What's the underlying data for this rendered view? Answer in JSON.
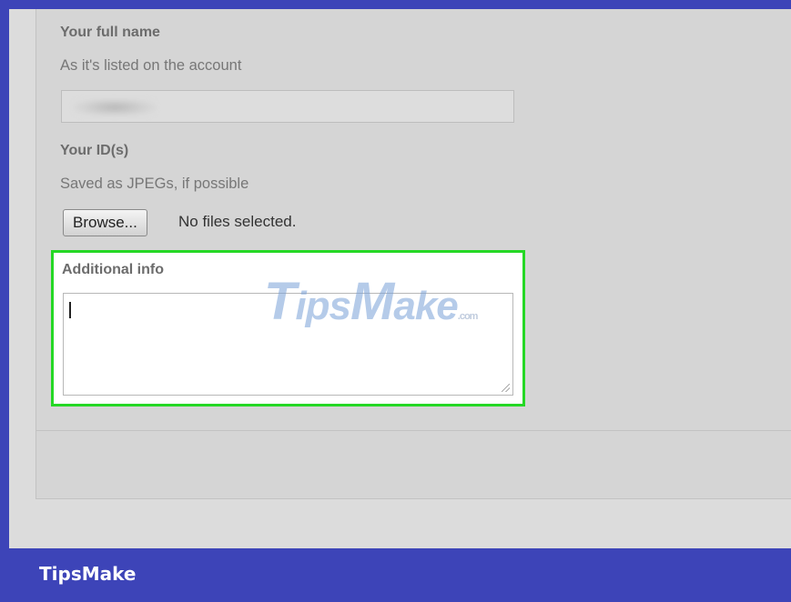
{
  "form": {
    "full_name": {
      "label": "Your full name",
      "hint": "As it's listed on the account",
      "value": ""
    },
    "ids": {
      "label": "Your ID(s)",
      "hint": "Saved as JPEGs, if possible",
      "browse_label": "Browse...",
      "file_status": "No files selected."
    },
    "additional_info": {
      "label": "Additional info",
      "value": ""
    }
  },
  "watermark": {
    "t": "T",
    "ips": "ips",
    "m": "M",
    "ake": "ake",
    "domain": ".com"
  },
  "brand": "TipsMake",
  "colors": {
    "frame": "#3d44b8",
    "highlight": "#25d825",
    "background": "#dcdcdc"
  }
}
